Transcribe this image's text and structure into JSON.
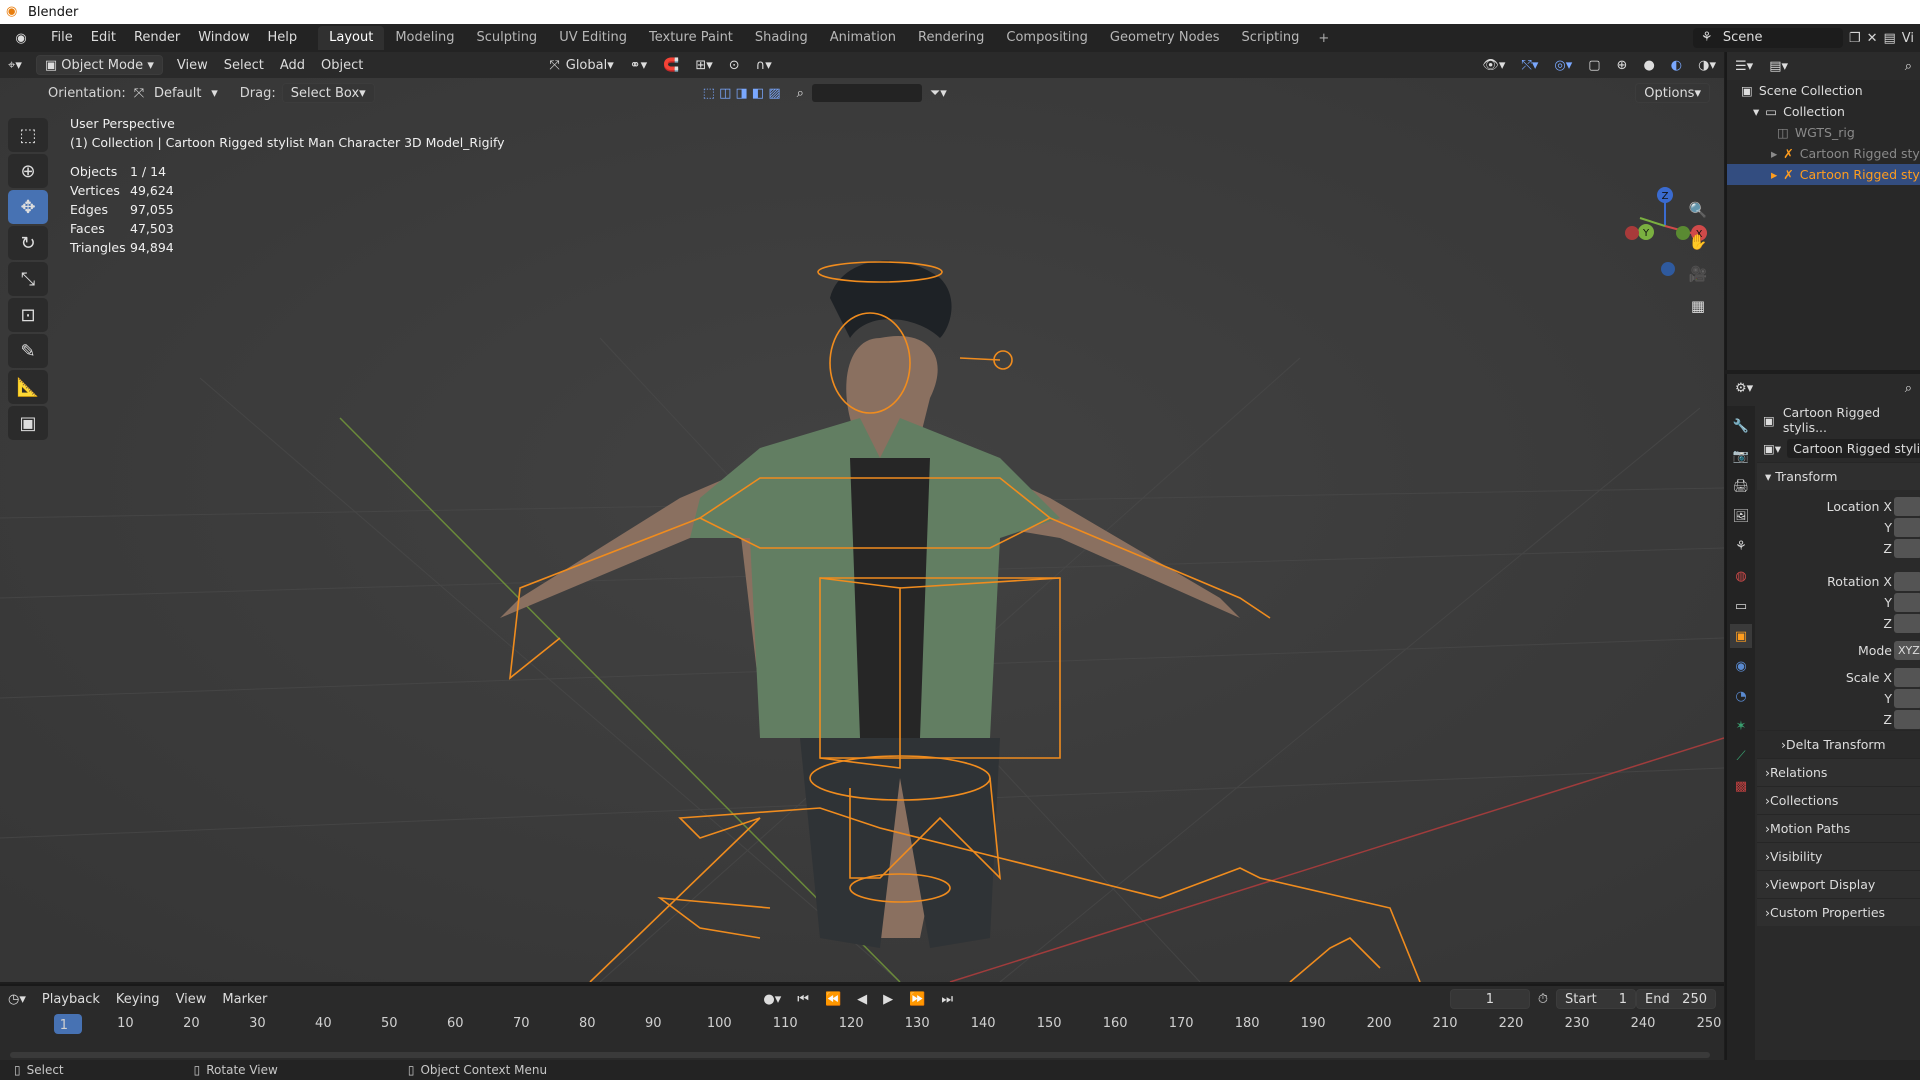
{
  "window": {
    "title": "Blender"
  },
  "menu": [
    "File",
    "Edit",
    "Render",
    "Window",
    "Help"
  ],
  "workspaces": [
    {
      "label": "Layout",
      "active": true
    },
    {
      "label": "Modeling"
    },
    {
      "label": "Sculpting"
    },
    {
      "label": "UV Editing"
    },
    {
      "label": "Texture Paint"
    },
    {
      "label": "Shading"
    },
    {
      "label": "Animation"
    },
    {
      "label": "Rendering"
    },
    {
      "label": "Compositing"
    },
    {
      "label": "Geometry Nodes"
    },
    {
      "label": "Scripting"
    }
  ],
  "add_workspace": "+",
  "scene": {
    "label": "Scene",
    "view_layer": "Vi"
  },
  "viewport_header": {
    "mode": "Object Mode",
    "menus": [
      "View",
      "Select",
      "Add",
      "Object"
    ],
    "transform": "Global",
    "options": "Options"
  },
  "tool_settings": {
    "orientation_label": "Orientation:",
    "orientation_value": "Default",
    "drag_label": "Drag:",
    "drag_value": "Select Box"
  },
  "overlay_info": {
    "view": "User Perspective",
    "collection": "(1) Collection | Cartoon Rigged stylist Man Character 3D Model_Rigify"
  },
  "stats": [
    {
      "k": "Objects",
      "v": "1 / 14"
    },
    {
      "k": "Vertices",
      "v": "49,624"
    },
    {
      "k": "Edges",
      "v": "97,055"
    },
    {
      "k": "Faces",
      "v": "47,503"
    },
    {
      "k": "Triangles",
      "v": "94,894"
    }
  ],
  "gizmo": {
    "z": "Z",
    "y": "Y",
    "x": "X"
  },
  "outliner": {
    "rows": [
      {
        "label": "Scene Collection",
        "indent": 0,
        "state": ""
      },
      {
        "label": "Collection",
        "indent": 1,
        "state": ""
      },
      {
        "label": "WGTS_rig",
        "indent": 2,
        "state": "dim"
      },
      {
        "label": "Cartoon Rigged stylist",
        "indent": 2,
        "state": "dim"
      },
      {
        "label": "Cartoon Rigged stylist",
        "indent": 2,
        "state": "sel"
      }
    ]
  },
  "properties": {
    "object_name": "Cartoon Rigged stylis...",
    "data_name": "Cartoon Rigged styli...",
    "transform_label": "Transform",
    "location": [
      "Location X",
      "Y",
      "Z"
    ],
    "rotation": [
      "Rotation X",
      "Y",
      "Z"
    ],
    "mode_label": "Mode",
    "mode_value": "XYZ",
    "scale": [
      "Scale X",
      "Y",
      "Z"
    ],
    "delta": "Delta Transform",
    "panels": [
      "Relations",
      "Collections",
      "Motion Paths",
      "Visibility",
      "Viewport Display",
      "Custom Properties"
    ]
  },
  "timeline": {
    "menus": [
      "Playback",
      "Keying",
      "View",
      "Marker"
    ],
    "current_frame": "1",
    "start_label": "Start",
    "start": "1",
    "end_label": "End",
    "end": "250",
    "ticks": [
      "10",
      "20",
      "30",
      "40",
      "50",
      "60",
      "70",
      "80",
      "90",
      "100",
      "110",
      "120",
      "130",
      "140",
      "150",
      "160",
      "170",
      "180",
      "190",
      "200",
      "210",
      "220",
      "230",
      "240",
      "250"
    ],
    "playhead": "1"
  },
  "statusbar": [
    "Select",
    "Rotate View",
    "Object Context Menu"
  ],
  "colors": {
    "accent": "#4772b3",
    "selected": "#ff9d1e",
    "rig": "#f08c1e"
  }
}
